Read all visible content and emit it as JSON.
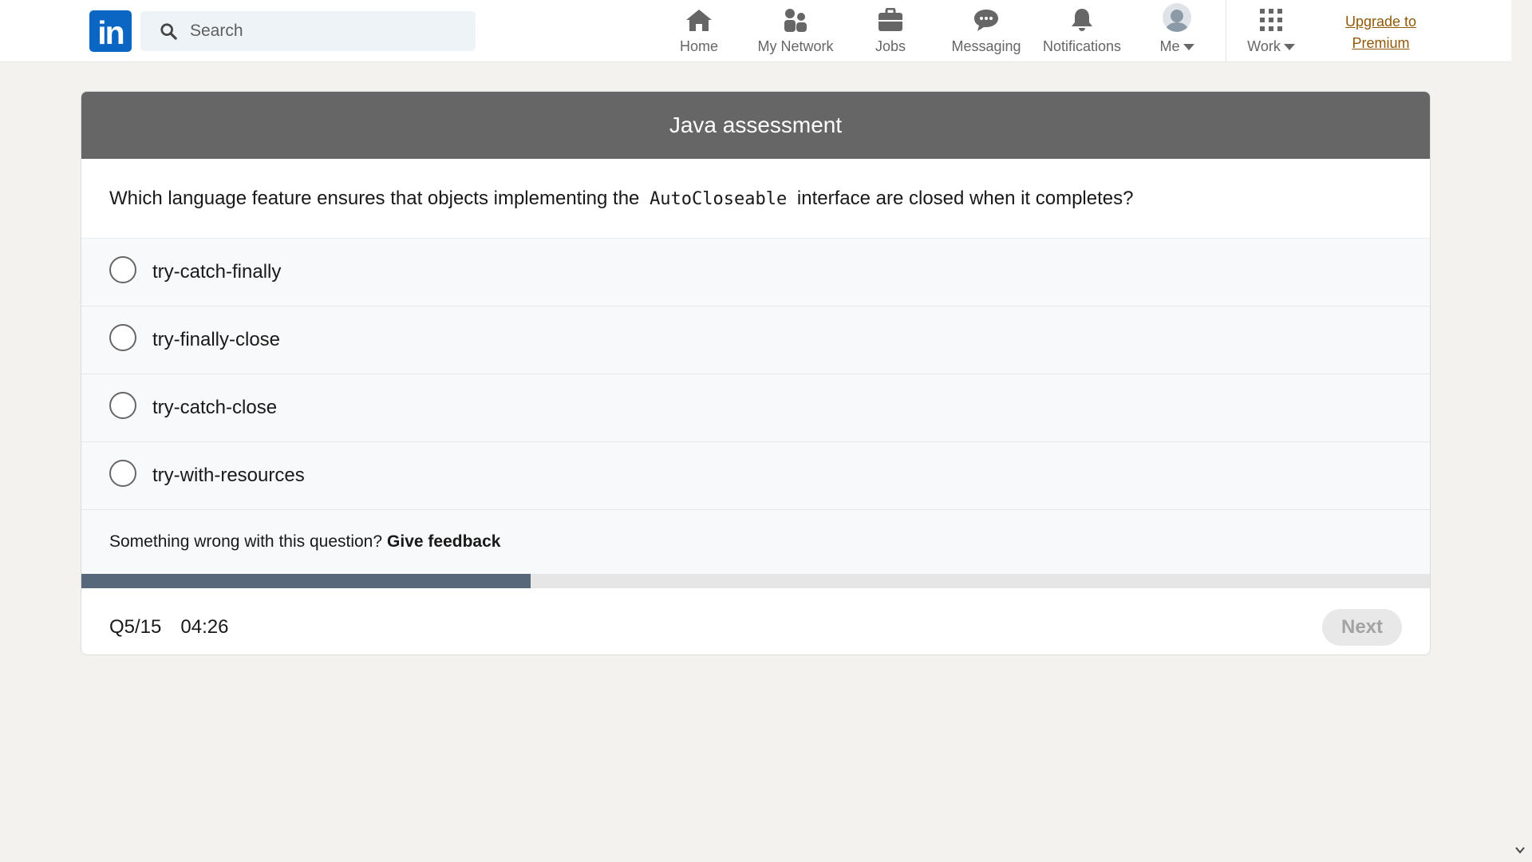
{
  "nav": {
    "logo_text": "in",
    "search_placeholder": "Search",
    "items": [
      {
        "label": "Home",
        "icon": "home-icon"
      },
      {
        "label": "My Network",
        "icon": "network-icon"
      },
      {
        "label": "Jobs",
        "icon": "briefcase-icon"
      },
      {
        "label": "Messaging",
        "icon": "chat-icon"
      },
      {
        "label": "Notifications",
        "icon": "bell-icon"
      },
      {
        "label": "Me",
        "icon": "avatar"
      },
      {
        "label": "Work",
        "icon": "grid-icon"
      }
    ],
    "premium_line1": "Upgrade to",
    "premium_line2": "Premium"
  },
  "assessment": {
    "title": "Java assessment",
    "question_before": "Which language feature ensures that objects implementing the",
    "question_code": "AutoCloseable",
    "question_after": "interface are closed when it completes?",
    "options": [
      {
        "label": "try-catch-finally"
      },
      {
        "label": "try-finally-close"
      },
      {
        "label": "try-catch-close"
      },
      {
        "label": "try-with-resources"
      }
    ],
    "feedback_prompt": "Something wrong with this question?",
    "feedback_link": "Give feedback",
    "progress_fraction": 0.333,
    "question_counter": "Q5/15",
    "timer": "04:26",
    "next_label": "Next"
  },
  "colors": {
    "brand": "#0a66c2",
    "header_bg": "#666666",
    "progress_fill": "#56687a",
    "premium": "#915907"
  }
}
